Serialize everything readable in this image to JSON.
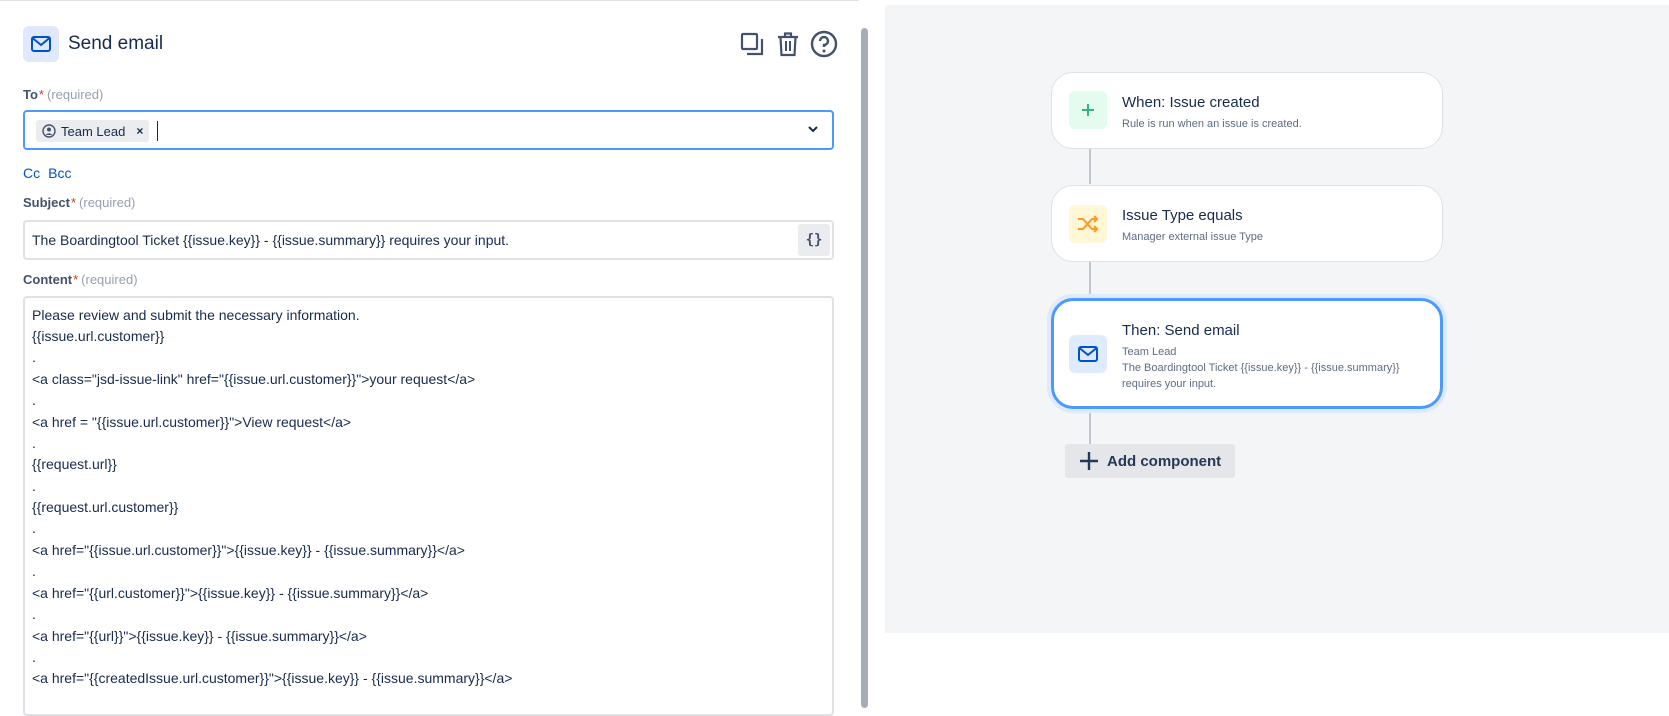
{
  "editor": {
    "title": "Send email",
    "icons": {
      "header": "mail-icon",
      "duplicate": "copy-icon",
      "delete": "trash-icon",
      "help": "help-icon"
    },
    "to": {
      "label": "To",
      "required_star": "*",
      "required_text": "(required)",
      "chip_label": "Team Lead",
      "chip_remove": "×"
    },
    "cc_label": "Cc",
    "bcc_label": "Bcc",
    "subject": {
      "label": "Subject",
      "required_star": "*",
      "required_text": "(required)",
      "value": "The Boardingtool Ticket {{issue.key}} - {{issue.summary}} requires your input.",
      "smart_values_button": "{}"
    },
    "content": {
      "label": "Content",
      "required_star": "*",
      "required_text": "(required)",
      "lines": [
        "Please review and submit the necessary information.",
        "{{issue.url.customer}}",
        ".",
        "<a class=\"jsd-issue-link\" href=\"{{issue.url.customer}}\">your request</a>",
        ".",
        "<a href = \"{{issue.url.customer}}\">View request</a>",
        ".",
        "{{request.url}}",
        ".",
        "{{request.url.customer}}",
        ".",
        "<a href=\"{{issue.url.customer}}\">{{issue.key}} - {{issue.summary}}</a>",
        ".",
        "<a href=\"{{url.customer}}\">{{issue.key}} - {{issue.summary}}</a>",
        ".",
        "<a href=\"{{url}}\">{{issue.key}} - {{issue.summary}}</a>",
        ".",
        "<a href=\"{{createdIssue.url.customer}}\">{{issue.key}} - {{issue.summary}}</a>"
      ]
    }
  },
  "rule": {
    "nodes": [
      {
        "title": "When: Issue created",
        "desc": [
          "Rule is run when an issue is created."
        ],
        "icon": "plus-icon",
        "color": "#36b37e",
        "bg": "#e3fcef"
      },
      {
        "title": "Issue Type equals",
        "desc": [
          "Manager external issue Type"
        ],
        "icon": "shuffle-icon",
        "color": "#ff991f",
        "bg": "#fff7d6"
      },
      {
        "title": "Then: Send email",
        "desc": [
          "Team Lead",
          "The Boardingtool Ticket {{issue.key}} - {{issue.summary}}",
          "requires your input."
        ],
        "icon": "mail-icon",
        "color": "#0052cc",
        "bg": "#deebff",
        "selected": true
      }
    ],
    "add_component_label": "Add component"
  }
}
